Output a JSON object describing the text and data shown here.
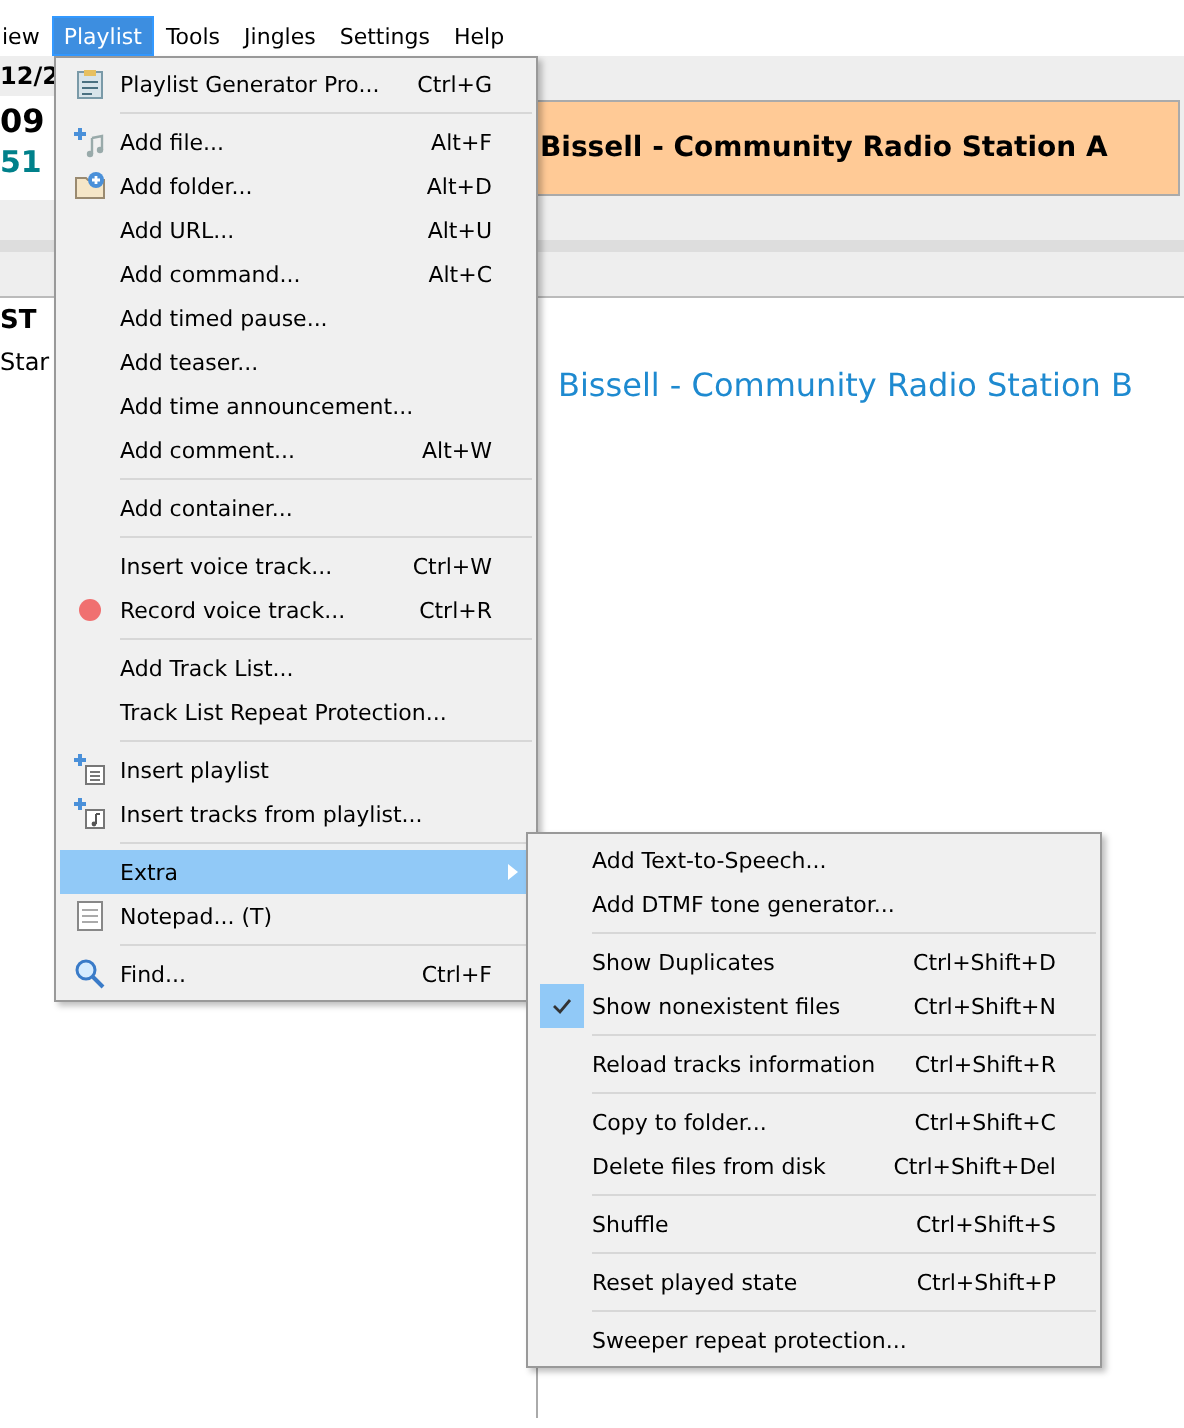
{
  "menubar": [
    {
      "label": "iew",
      "selected": false
    },
    {
      "label": "Playlist",
      "selected": true
    },
    {
      "label": "Tools",
      "selected": false
    },
    {
      "label": "Jingles",
      "selected": false
    },
    {
      "label": "Settings",
      "selected": false
    },
    {
      "label": "Help",
      "selected": false
    }
  ],
  "background": {
    "date": "12/2",
    "time": "09",
    "counter": "51",
    "now_playing": "Bissell - Community Radio Station A",
    "list_header": "ST",
    "list_item": "Star",
    "next_track": "Bissell - Community Radio Station B"
  },
  "playlist_menu": [
    {
      "kind": "item",
      "label": "Playlist Generator Pro...",
      "shortcut": "Ctrl+G",
      "selected": false
    },
    {
      "kind": "separator"
    },
    {
      "kind": "item",
      "label": "Add file...",
      "shortcut": "Alt+F",
      "selected": false
    },
    {
      "kind": "item",
      "label": "Add folder...",
      "shortcut": "Alt+D",
      "selected": false
    },
    {
      "kind": "item",
      "label": "Add URL...",
      "shortcut": "Alt+U",
      "selected": false
    },
    {
      "kind": "item",
      "label": "Add command...",
      "shortcut": "Alt+C",
      "selected": false
    },
    {
      "kind": "item",
      "label": "Add timed pause...",
      "selected": false
    },
    {
      "kind": "item",
      "label": "Add teaser...",
      "selected": false
    },
    {
      "kind": "item",
      "label": "Add time announcement...",
      "selected": false
    },
    {
      "kind": "item",
      "label": "Add comment...",
      "shortcut": "Alt+W",
      "selected": false
    },
    {
      "kind": "separator"
    },
    {
      "kind": "item",
      "label": "Add container...",
      "selected": false
    },
    {
      "kind": "separator"
    },
    {
      "kind": "item",
      "label": "Insert voice track...",
      "shortcut": "Ctrl+W",
      "selected": false
    },
    {
      "kind": "item",
      "label": "Record voice track...",
      "shortcut": "Ctrl+R",
      "selected": false
    },
    {
      "kind": "separator"
    },
    {
      "kind": "item",
      "label": "Add Track List...",
      "selected": false
    },
    {
      "kind": "item",
      "label": "Track List Repeat Protection...",
      "selected": false
    },
    {
      "kind": "separator"
    },
    {
      "kind": "item",
      "label": "Insert playlist",
      "selected": false
    },
    {
      "kind": "item",
      "label": "Insert tracks from playlist...",
      "selected": false
    },
    {
      "kind": "separator"
    },
    {
      "kind": "submenu",
      "label": "Extra",
      "selected": true
    },
    {
      "kind": "item",
      "label": "Notepad... (T)",
      "selected": false
    },
    {
      "kind": "separator"
    },
    {
      "kind": "item",
      "label": "Find...",
      "shortcut": "Ctrl+F",
      "selected": false
    }
  ],
  "extra_menu": [
    {
      "kind": "item",
      "label": "Add Text-to-Speech...",
      "checked": false
    },
    {
      "kind": "item",
      "label": "Add DTMF tone generator...",
      "checked": false
    },
    {
      "kind": "separator"
    },
    {
      "kind": "item",
      "label": "Show Duplicates",
      "shortcut": "Ctrl+Shift+D",
      "checked": false
    },
    {
      "kind": "item",
      "label": "Show nonexistent files",
      "shortcut": "Ctrl+Shift+N",
      "checked": true
    },
    {
      "kind": "separator"
    },
    {
      "kind": "item",
      "label": "Reload tracks information",
      "shortcut": "Ctrl+Shift+R",
      "checked": false
    },
    {
      "kind": "separator"
    },
    {
      "kind": "item",
      "label": "Copy to folder...",
      "shortcut": "Ctrl+Shift+C",
      "checked": false
    },
    {
      "kind": "item",
      "label": "Delete files from disk",
      "shortcut": "Ctrl+Shift+Del",
      "checked": false
    },
    {
      "kind": "separator"
    },
    {
      "kind": "item",
      "label": "Shuffle",
      "shortcut": "Ctrl+Shift+S",
      "checked": false
    },
    {
      "kind": "separator"
    },
    {
      "kind": "item",
      "label": "Reset played state",
      "shortcut": "Ctrl+Shift+P",
      "checked": false
    },
    {
      "kind": "separator"
    },
    {
      "kind": "item",
      "label": "Sweeper repeat protection...",
      "checked": false
    }
  ]
}
